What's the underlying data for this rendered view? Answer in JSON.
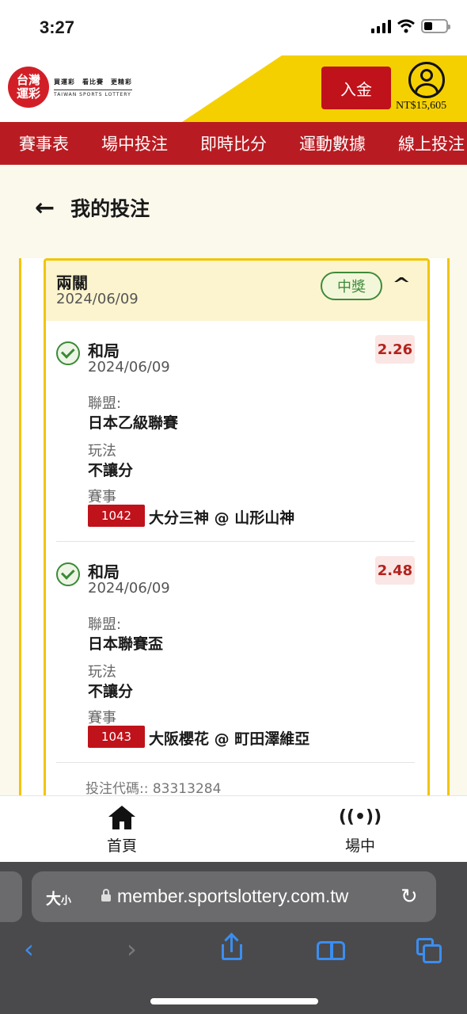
{
  "status_bar": {
    "time": "3:27"
  },
  "header": {
    "logo_text": "台灣運彩",
    "logo_slogan": "買運彩　看比賽　更精彩",
    "logo_en": "TAIWAN SPORTS LOTTERY",
    "deposit_label": "入金",
    "balance": "NT$15,605",
    "brand_color": "#c0121a",
    "accent_color": "#f5d000"
  },
  "nav": {
    "items": [
      "賽事表",
      "場中投注",
      "即時比分",
      "運動數據",
      "線上投注"
    ]
  },
  "page": {
    "title": "我的投注"
  },
  "bet": {
    "type": "兩關",
    "date": "2024/06/09",
    "status": "中獎",
    "legs": [
      {
        "pick": "和局",
        "date": "2024/06/09",
        "odds": "2.26",
        "league_label": "聯盟:",
        "league": "日本乙級聯賽",
        "play_label": "玩法",
        "play": "不讓分",
        "event_label": "賽事",
        "match_no": "1042",
        "match": "大分三神 @ 山形山神"
      },
      {
        "pick": "和局",
        "date": "2024/06/09",
        "odds": "2.48",
        "league_label": "聯盟:",
        "league": "日本聯賽盃",
        "play_label": "玩法",
        "play": "不讓分",
        "event_label": "賽事",
        "match_no": "1043",
        "match": "大阪櫻花 @ 町田澤維亞"
      }
    ],
    "code_label": "投注代碼:: 83313284"
  },
  "bottom_tabs": [
    {
      "label": "首頁",
      "icon": "home-icon"
    },
    {
      "label": "場中",
      "icon": "live-broadcast-icon"
    }
  ],
  "browser": {
    "text_size_label": "大",
    "text_size_small": "小",
    "url": "member.sportslottery.com.tw"
  }
}
